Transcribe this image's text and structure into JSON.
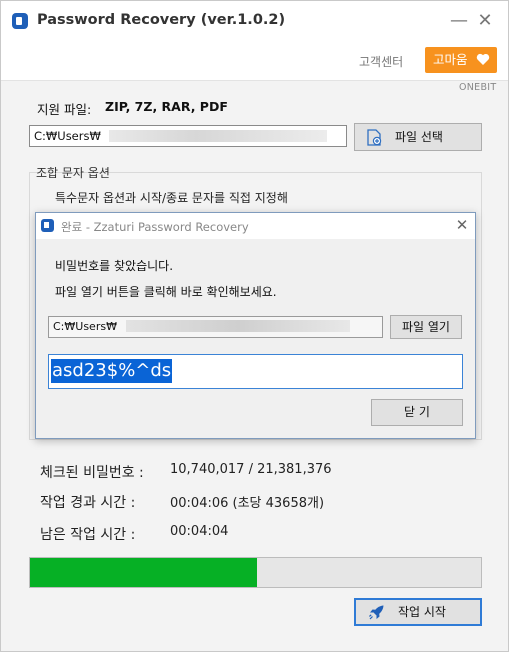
{
  "app": {
    "title": "Password Recovery (ver.1.0.2)",
    "minimize_glyph": "—",
    "close_glyph": "✕"
  },
  "topbar": {
    "support_label": "고객센터",
    "thanks_label": "고마움",
    "brand": "ONEBIT"
  },
  "main": {
    "supported_label": "지원 파일:",
    "supported_types": "ZIP, 7Z, RAR, PDF",
    "file_path": "C:₩Users₩",
    "select_file_label": "파일 선택",
    "options_group_label": "조합 문자 옵션",
    "options_desc": "특수문자 옵션과 시작/종료 문자를 직접 지정해"
  },
  "dialog": {
    "title": "완료 - Zzaturi Password Recovery",
    "close_glyph": "✕",
    "message_line1": "비밀번호를 찾았습니다.",
    "message_line2": "파일 열기 버튼을 클릭해 바로 확인해보세요.",
    "path": "C:₩Users₩",
    "open_file_label": "파일 열기",
    "password": "asd23$%^ds",
    "close_label": "닫 기"
  },
  "stats": {
    "checked_label": "체크된 비밀번호 :",
    "checked_value": "10,740,017 / 21,381,376",
    "elapsed_label": "작업 경과 시간 :",
    "elapsed_value": "00:04:06 (초당 43658개)",
    "remaining_label": "남은 작업 시간 :",
    "remaining_value": "00:04:04"
  },
  "progress": {
    "fraction": 0.5023,
    "color": "#06b025"
  },
  "actions": {
    "start_label": "작업 시작"
  },
  "colors": {
    "accent_orange": "#f7921e",
    "focus_blue": "#2f7bd6",
    "selection_blue": "#0a64d6"
  }
}
